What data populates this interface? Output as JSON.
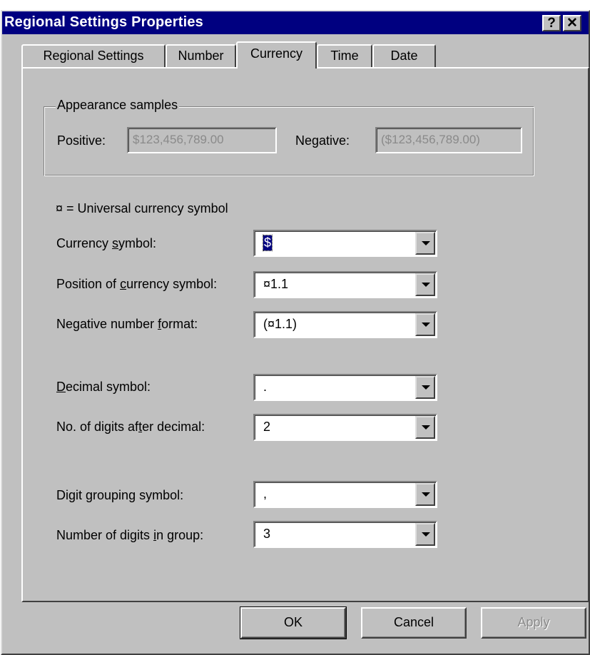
{
  "window": {
    "title": "Regional Settings Properties",
    "help_glyph": "?",
    "close_glyph": "✕"
  },
  "tabs": [
    {
      "label": "Regional Settings",
      "active": false
    },
    {
      "label": "Number",
      "active": false
    },
    {
      "label": "Currency",
      "active": true
    },
    {
      "label": "Time",
      "active": false
    },
    {
      "label": "Date",
      "active": false
    }
  ],
  "appearance": {
    "legend": "Appearance samples",
    "positive_label": "Positive:",
    "positive_value": "$123,456,789.00",
    "negative_label": "Negative:",
    "negative_value": "($123,456,789.00)"
  },
  "universal_note": "¤ = Universal currency symbol",
  "fields": {
    "currency_symbol": {
      "label_pre": "Currency ",
      "label_key": "s",
      "label_post": "ymbol:",
      "value": "$"
    },
    "position_symbol": {
      "label_pre": "Position of ",
      "label_key": "c",
      "label_post": "urrency symbol:",
      "value": "¤1.1"
    },
    "negative_format": {
      "label_pre": "Negative number ",
      "label_key": "f",
      "label_post": "ormat:",
      "value": "(¤1.1)"
    },
    "decimal_symbol": {
      "label_pre": "",
      "label_key": "D",
      "label_post": "ecimal symbol:",
      "value": "."
    },
    "digits_after_decimal": {
      "label_pre": "No. of digits af",
      "label_key": "t",
      "label_post": "er decimal:",
      "value": "2"
    },
    "digit_grouping_symbol": {
      "label_pre": "Digit ",
      "label_key": "g",
      "label_post": "rouping symbol:",
      "value": ","
    },
    "digits_in_group": {
      "label_pre": "Number of digits ",
      "label_key": "i",
      "label_post": "n group:",
      "value": "3"
    }
  },
  "buttons": {
    "ok": "OK",
    "cancel": "Cancel",
    "apply": "Apply"
  },
  "colors": {
    "titlebar": "#000080",
    "face": "#c0c0c0"
  }
}
